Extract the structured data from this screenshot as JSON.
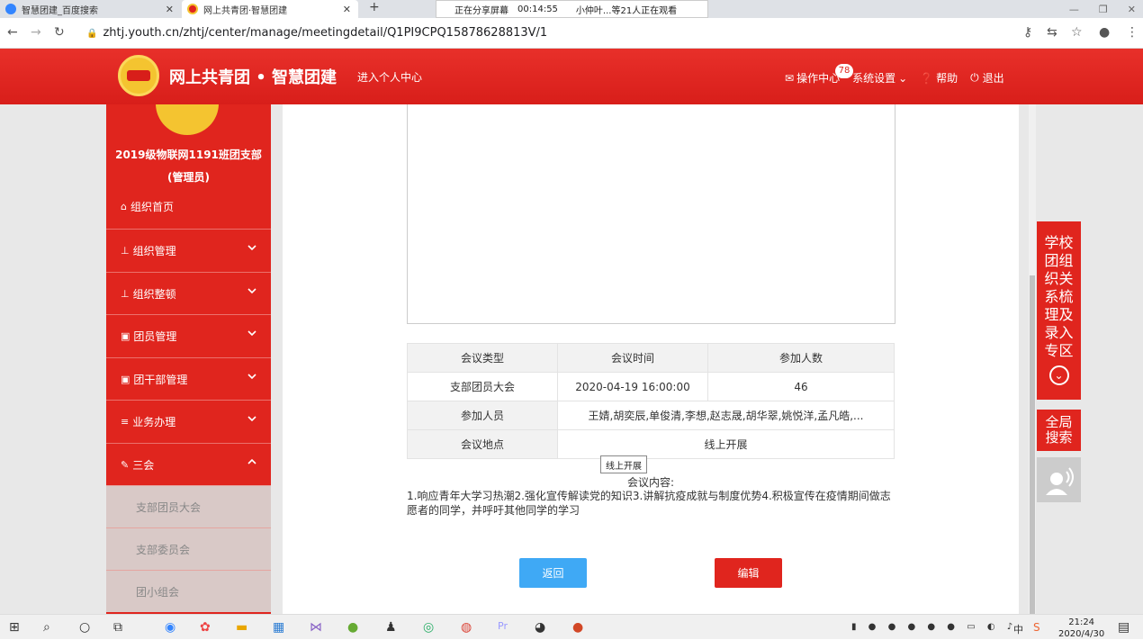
{
  "browser": {
    "tabs": [
      {
        "label": "智慧团建_百度搜索",
        "active": false
      },
      {
        "label": "网上共青团·智慧团建",
        "active": true
      }
    ],
    "new_tab": "+",
    "share_banner": {
      "status": "正在分享屏幕",
      "elapsed": "00:14:55",
      "viewers": "小仲叶...等21人正在观看"
    },
    "url": "zhtj.youth.cn/zhtj/center/manage/meetingdetail/Q1PI9CPQ15878628813V/1"
  },
  "header": {
    "site_title": "网上共青团 • 智慧团建",
    "personal_center": "进入个人中心",
    "ops_center": "操作中心",
    "ops_badge": "78",
    "settings": "系统设置",
    "help": "帮助",
    "logout": "退出"
  },
  "sidebar": {
    "org_name": "2019级物联网1191班团支部",
    "role": "(管理员)",
    "menu": [
      {
        "icon": "home-icon",
        "label": "组织首页",
        "expandable": false
      },
      {
        "icon": "org-chart-icon",
        "label": "组织管理",
        "expandable": true
      },
      {
        "icon": "org-chart-icon",
        "label": "组织整顿",
        "expandable": true
      },
      {
        "icon": "member-icon",
        "label": "团员管理",
        "expandable": true
      },
      {
        "icon": "member-icon",
        "label": "团干部管理",
        "expandable": true
      },
      {
        "icon": "list-icon",
        "label": "业务办理",
        "expandable": true
      },
      {
        "icon": "edit-icon",
        "label": "三会",
        "expandable": true,
        "expanded": true
      }
    ],
    "submenu": [
      "支部团员大会",
      "支部委员会",
      "团小组会"
    ]
  },
  "meeting": {
    "headers": [
      "会议类型",
      "会议时间",
      "参加人数"
    ],
    "type": "支部团员大会",
    "time": "2020-04-19 16:00:00",
    "count": "46",
    "participants_label": "参加人员",
    "participants": "王婧,胡奕辰,单俊清,李想,赵志晟,胡华翠,姚悦洋,孟凡皓,...",
    "location_label": "会议地点",
    "location": "线上开展",
    "tooltip": "线上开展",
    "content_label": "会议内容:",
    "content": "1.响应青年大学习热潮2.强化宣传解读党的知识3.讲解抗疫成就与制度优势4.积极宣传在疫情期间做志愿者的同学，并呼吁其他同学的学习"
  },
  "actions": {
    "back": "返回",
    "edit": "编辑"
  },
  "float": {
    "special": "学校团组织关系梳理及录入专区",
    "global_search": "全局搜索"
  },
  "taskbar": {
    "time": "21:24",
    "date": "2020/4/30",
    "ime": "中"
  },
  "colors": {
    "brand_red": "#e0251e",
    "back_blue": "#3fa9f5",
    "gold": "#f4c430"
  }
}
